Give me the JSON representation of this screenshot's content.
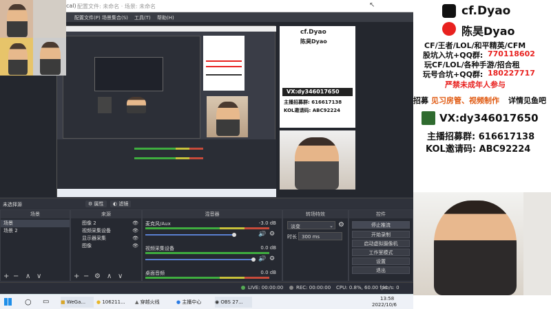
{
  "obs": {
    "title_fragment": "cal)",
    "title_extra": "配置文件: 未命名 · 场景: 未命名",
    "menu": [
      "配置文件(P)",
      "场景集合(S)",
      "工具(T)",
      "帮助(H)"
    ],
    "source_status": "未选择源",
    "properties_label": "属性",
    "filters_label": "滤镜",
    "scenes_title": "场景",
    "scenes": [
      "场景",
      "场景 2"
    ],
    "sources_title": "来源",
    "sources": [
      "图像 2",
      "视频采集设备",
      "显示器采集",
      "图像"
    ],
    "mixer_title": "混音器",
    "mixer": [
      {
        "name": "麦克风/Aux",
        "db": "-3.0 dB"
      },
      {
        "name": "视频采集设备",
        "db": "0.0 dB"
      },
      {
        "name": "桌面音频",
        "db": "0.0 dB"
      }
    ],
    "transitions_title": "转场特效",
    "transition_value": "淡变",
    "duration_label": "时长",
    "duration_value": "300 ms",
    "controls_title": "控件",
    "controls": [
      "停止推流",
      "开始录制",
      "启动虚拟摄像机",
      "工作室模式",
      "设置",
      "退出"
    ],
    "status_live": "LIVE: 00:00:00",
    "status_rec": "REC: 00:00:00",
    "status_cpu": "CPU: 0.8%, 60.00 fps",
    "status_kbps": "kb/s: 0"
  },
  "taskbar": {
    "items": [
      "WeGa...",
      "106211...",
      "穿越火线",
      "主播中心",
      "OBS 27..."
    ],
    "time": "13:58",
    "date": "2022/10/6"
  },
  "promo": {
    "tiktok_name": "cf.Dyao",
    "weibo_name": "陈昊Dyao",
    "line1": "CF/王者/LOL/和平精英/CFM",
    "line2_label": "股坑入坑+QQ群:",
    "line2_value": "770118602",
    "line3": "玩CF/LOL/各种手游/招合租",
    "line4_label": "玩号合坑+QQ群:",
    "line4_value": "180227717",
    "line5": "严禁未成年人参与",
    "line6_a": "招募",
    "line6_b": "见习房管、视频制作",
    "line6_c": "详情见鱼吧",
    "vx": "VX:dy346017650",
    "recruit": "主播招募群:  616617138",
    "kol": "KOL邀请码:  ABC92224"
  },
  "colors": {
    "accent_red": "#e8211f",
    "promo_orange": "#e05a12",
    "obs_bg": "#2b2e38"
  }
}
